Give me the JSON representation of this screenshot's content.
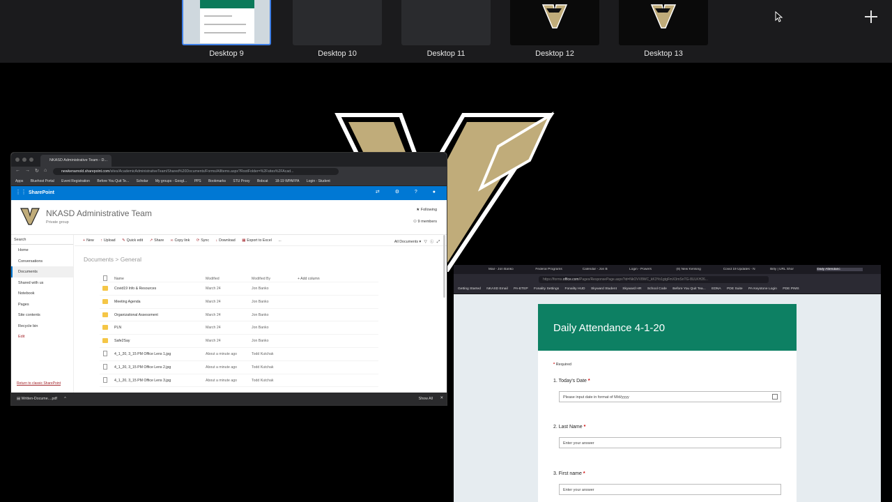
{
  "spaces": {
    "desktops": [
      {
        "label": "Desktop 9",
        "active": true,
        "thumb": "forms-preview"
      },
      {
        "label": "Desktop 10",
        "active": false,
        "thumb": "blank"
      },
      {
        "label": "Desktop 11",
        "active": false,
        "thumb": "blank"
      },
      {
        "label": "Desktop 12",
        "active": false,
        "thumb": "logo"
      },
      {
        "label": "Desktop 13",
        "active": false,
        "thumb": "logo"
      }
    ],
    "add_icon": "plus-icon"
  },
  "sharepoint_browser": {
    "tab_title": "NKASD Administrative Team - D...",
    "url_host": "newkenarnold.sharepoint.com",
    "url_path": "/sites/AcademicAdministrativeTeam/Shared%20Documents/Forms/AllItems.aspx?RootFolder=%2Fsites%2FAcad...",
    "bookmarks": [
      "Apps",
      "Bluehost Portal",
      "Event Registration",
      "Before You Quit Te...",
      "Scholar",
      "My groups - Googl...",
      "PPS",
      "Bookmarks",
      "STU Proxy",
      "Bobcat",
      "18-19 WPAFPA",
      "Login - Student"
    ],
    "suite_brand": "SharePoint",
    "site_title": "NKASD Administrative Team",
    "site_sub": "Private group",
    "following": "Following",
    "members": "9 members",
    "search_placeholder": "Search",
    "nav": [
      "Home",
      "Conversations",
      "Documents",
      "Shared with us",
      "Notebook",
      "Pages",
      "Site contents",
      "Recycle bin",
      "Edit"
    ],
    "classic_link": "Return to classic SharePoint",
    "commands": [
      "New",
      "Upload",
      "Quick edit",
      "Share",
      "Copy link",
      "Sync",
      "Download",
      "Export to Excel",
      "..."
    ],
    "view_label": "All Documents",
    "breadcrumb": {
      "root": "Documents",
      "sep": ">",
      "current": "General"
    },
    "columns": {
      "name": "Name",
      "modified": "Modified",
      "modified_by": "Modified By",
      "add_column": "+ Add column"
    },
    "rows": [
      {
        "type": "folder",
        "name": "Covid19 Info & Resources",
        "modified": "March 24",
        "by": "Jon Banko"
      },
      {
        "type": "folder",
        "name": "Meeting Agenda",
        "modified": "March 24",
        "by": "Jon Banko"
      },
      {
        "type": "folder",
        "name": "Organizational Assessment",
        "modified": "March 24",
        "by": "Jon Banko"
      },
      {
        "type": "folder",
        "name": "PLN",
        "modified": "March 24",
        "by": "Jon Banko"
      },
      {
        "type": "folder",
        "name": "Safe2Say",
        "modified": "March 24",
        "by": "Jon Banko"
      },
      {
        "type": "file",
        "name": "4_1_20, 3_15 PM Office Lens 1.jpg",
        "modified": "About a minute ago",
        "by": "Todd Kutchak"
      },
      {
        "type": "file",
        "name": "4_1_20, 3_15 PM Office Lens 2.jpg",
        "modified": "About a minute ago",
        "by": "Todd Kutchak"
      },
      {
        "type": "file",
        "name": "4_1_20, 3_15 PM Office Lens 3.jpg",
        "modified": "About a minute ago",
        "by": "Todd Kutchak"
      }
    ],
    "download_file": "Written-Docume....pdf",
    "show_all": "Show All"
  },
  "forms_browser": {
    "tabs": [
      "Mail - Jon Banko",
      "Federal Programs",
      "Calendar - Jon B",
      "Login - Powers",
      "(8) New Kensing",
      "Covid 19 Updates - N",
      "Bitly | URL Shor",
      "Daily Attendanc"
    ],
    "url_prefix": "https://forms.",
    "url_host": "office.com",
    "url_path": "/Pages/ResponsePage.aspx?id=NkOVV8WC_kK3Yo1gtgFmX3mSnTG-8ULKH26...",
    "bookmarks": [
      "Getting Started",
      "NKASD Email",
      "PA-ETEP",
      "Fonality Settings",
      "Fonality HUD",
      "Skyward Student",
      "Skyward HR",
      "School Code",
      "Before You Quit Tea...",
      "EDNA",
      "PDE Suite",
      "PA Keystone Login",
      "PDE PIMS"
    ],
    "form_title": "Daily Attendance 4-1-20",
    "required_note": "Required",
    "questions": [
      {
        "label": "1. Today's Date",
        "placeholder": "Please input date in format of M/d/yyyy"
      },
      {
        "label": "2. Last Name",
        "placeholder": "Enter your answer"
      },
      {
        "label": "3. First name",
        "placeholder": "Enter your answer"
      }
    ]
  },
  "colors": {
    "sharepoint_blue": "#0078d4",
    "forms_green": "#0d8063",
    "logo_gold": "#c0ac7a",
    "active_space_border": "#3f7fe6"
  }
}
